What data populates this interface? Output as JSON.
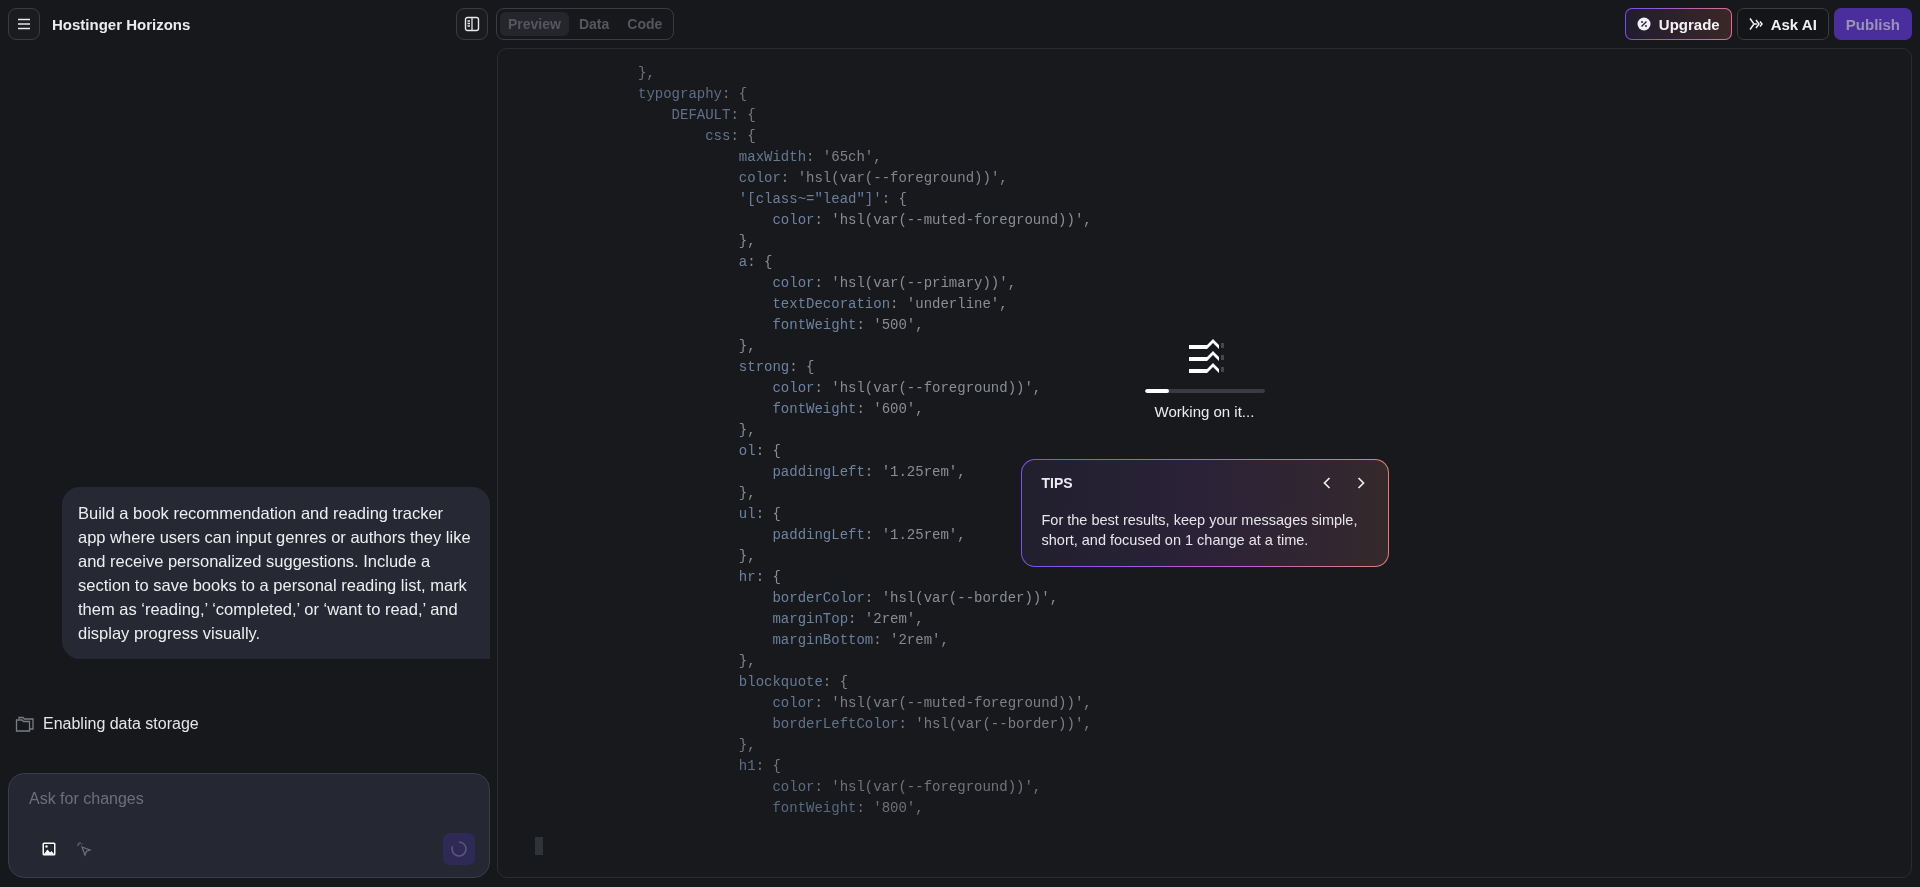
{
  "header": {
    "title": "Hostinger Horizons",
    "view_tabs": [
      {
        "label": "Preview",
        "selected": true
      },
      {
        "label": "Data",
        "selected": false
      },
      {
        "label": "Code",
        "selected": false
      }
    ],
    "actions": [
      {
        "label": "Upgrade",
        "kind": "upgrade"
      },
      {
        "label": "Ask AI",
        "kind": "ask"
      },
      {
        "label": "Publish",
        "kind": "publish"
      }
    ]
  },
  "chat": {
    "message": "Build a book recommendation and reading tracker app where users can input genres or authors they like and receive personalized suggestions. Include a section to save books to a personal reading list, mark them as ‘reading,’ ‘completed,’ or ‘want to read,’ and display progress visually.",
    "status": "Enabling data storage",
    "input": {
      "placeholder": "Ask for changes"
    }
  },
  "editor": {
    "lines": [
      "},",
      "typography: {",
      "    DEFAULT: {",
      "        css: {",
      "            maxWidth: '65ch',",
      "            color: 'hsl(var(--foreground))',",
      "            '[class~=\"lead\"]': {",
      "                color: 'hsl(var(--muted-foreground))',",
      "            },",
      "            a: {",
      "                color: 'hsl(var(--primary))',",
      "                textDecoration: 'underline',",
      "                fontWeight: '500',",
      "            },",
      "            strong: {",
      "                color: 'hsl(var(--foreground))',",
      "                fontWeight: '600',",
      "            },",
      "            ol: {",
      "                paddingLeft: '1.25rem',",
      "            },",
      "            ul: {",
      "                paddingLeft: '1.25rem',",
      "            },",
      "            hr: {",
      "                borderColor: 'hsl(var(--border))',",
      "                marginTop: '2rem',",
      "                marginBottom: '2rem',",
      "            },",
      "            blockquote: {",
      "                color: 'hsl(var(--muted-foreground))',",
      "                borderLeftColor: 'hsl(var(--border))',",
      "            },",
      "            h1: {",
      "                color: 'hsl(var(--foreground))',",
      "                fontWeight: '800',"
    ]
  },
  "loader": {
    "level": 0.2,
    "text": "Working on it..."
  },
  "tips": {
    "title": "TIPS",
    "text": "For the best results, keep your messages simple, short, and focused on 1 change at a time."
  }
}
